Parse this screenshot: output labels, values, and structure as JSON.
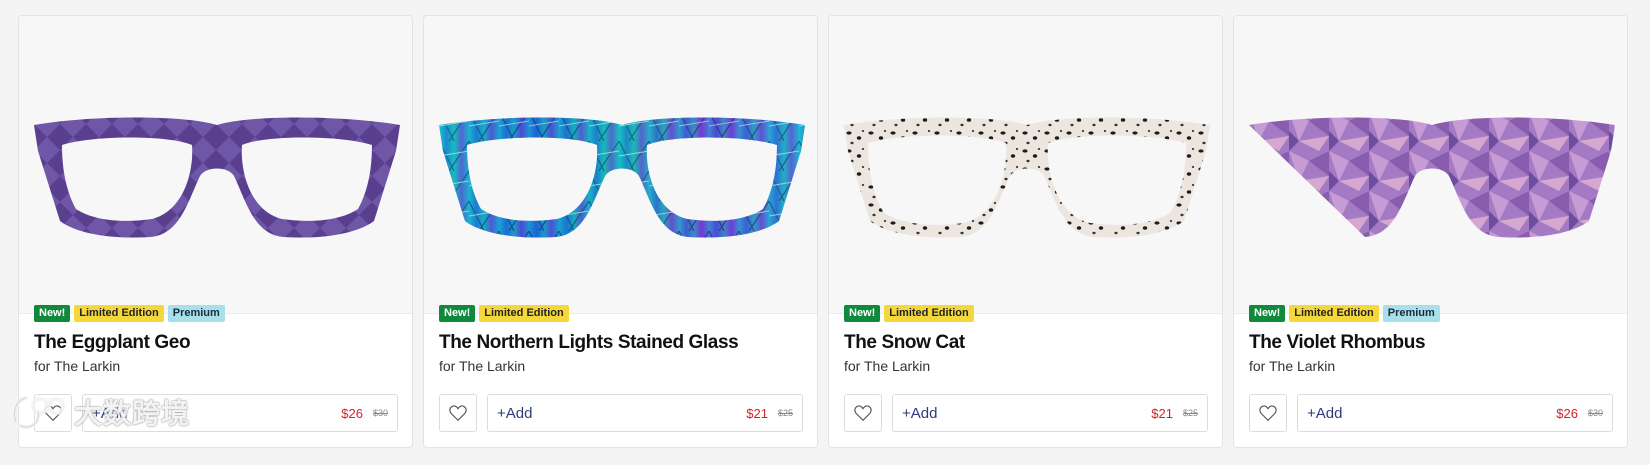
{
  "products": [
    {
      "name": "The Eggplant Geo",
      "subtitle": "for The Larkin",
      "badges": [
        {
          "text": "New!",
          "kind": "new"
        },
        {
          "text": "Limited Edition",
          "kind": "limited"
        },
        {
          "text": "Premium",
          "kind": "premium"
        }
      ],
      "add_label": "+Add",
      "price": "$26",
      "old_price": "$30",
      "frame_pattern": "purple-geo",
      "frame_colors": [
        "#5a3f8e",
        "#7a5fb2"
      ]
    },
    {
      "name": "The Northern Lights Stained Glass",
      "subtitle": "for The Larkin",
      "badges": [
        {
          "text": "New!",
          "kind": "new"
        },
        {
          "text": "Limited Edition",
          "kind": "limited"
        }
      ],
      "add_label": "+Add",
      "price": "$21",
      "old_price": "$25",
      "frame_pattern": "stained-glass",
      "frame_colors": [
        "#19b7c9",
        "#2a4fd1"
      ]
    },
    {
      "name": "The Snow Cat",
      "subtitle": "for The Larkin",
      "badges": [
        {
          "text": "New!",
          "kind": "new"
        },
        {
          "text": "Limited Edition",
          "kind": "limited"
        }
      ],
      "add_label": "+Add",
      "price": "$21",
      "old_price": "$25",
      "frame_pattern": "snow-leopard",
      "frame_colors": [
        "#ece6df",
        "#1d1d1d"
      ]
    },
    {
      "name": "The Violet Rhombus",
      "subtitle": "for The Larkin",
      "badges": [
        {
          "text": "New!",
          "kind": "new"
        },
        {
          "text": "Limited Edition",
          "kind": "limited"
        },
        {
          "text": "Premium",
          "kind": "premium"
        }
      ],
      "add_label": "+Add",
      "price": "$26",
      "old_price": "$30",
      "frame_pattern": "violet-rhombus",
      "frame_colors": [
        "#a37ac3",
        "#c79bd3"
      ]
    }
  ],
  "watermark": {
    "text": "大数跨境"
  },
  "colors": {
    "price": "#d3222a",
    "add": "#2c3b7a",
    "badge_new": "#0f8a3a",
    "badge_limited": "#f4d83b",
    "badge_premium": "#a7dfeb"
  }
}
